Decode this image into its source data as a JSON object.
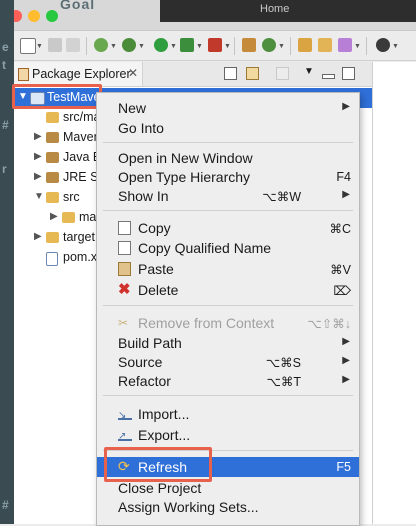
{
  "background": {
    "top_text": "Goal",
    "top_right_text": "Home",
    "left_chars": [
      "e",
      "t",
      "#",
      "r",
      "#"
    ]
  },
  "explorer": {
    "tab_label": "Package Explorer",
    "tab_close": "✕",
    "tree": [
      {
        "label": "TestMaven",
        "twisty": "▼",
        "icon": "maven-project-icon",
        "selected": true
      },
      {
        "label": "src/ma",
        "twisty": "",
        "icon": "source-folder-icon"
      },
      {
        "label": "Maven",
        "twisty": "▶",
        "icon": "library-icon"
      },
      {
        "label": "Java E",
        "twisty": "▶",
        "icon": "library-icon"
      },
      {
        "label": "JRE Sy",
        "twisty": "▶",
        "icon": "library-icon"
      },
      {
        "label": "src",
        "twisty": "▼",
        "icon": "folder-icon"
      },
      {
        "label": "mai",
        "twisty": "▶",
        "icon": "folder-icon"
      },
      {
        "label": "target",
        "twisty": "▶",
        "icon": "folder-icon"
      },
      {
        "label": "pom.x",
        "twisty": "",
        "icon": "pom-file-icon"
      }
    ]
  },
  "context_menu": {
    "items": [
      {
        "label": "New",
        "shortcut": "",
        "submenu": true
      },
      {
        "label": "Go Into",
        "shortcut": "",
        "submenu": false
      },
      {
        "label": "Open in New Window",
        "shortcut": "",
        "submenu": false
      },
      {
        "label": "Open Type Hierarchy",
        "shortcut": "F4",
        "submenu": false
      },
      {
        "label": "Show In",
        "shortcut": "⌥⌘W",
        "submenu": true
      },
      {
        "label": "Copy",
        "shortcut": "⌘C",
        "icon": "copy-icon"
      },
      {
        "label": "Copy Qualified Name",
        "shortcut": "",
        "icon": "copy-qualified-name-icon"
      },
      {
        "label": "Paste",
        "shortcut": "⌘V",
        "icon": "paste-icon"
      },
      {
        "label": "Delete",
        "shortcut": "⌦",
        "icon": "delete-icon"
      },
      {
        "label": "Remove from Context",
        "shortcut": "⌥⇧⌘↓",
        "icon": "remove-context-icon",
        "disabled": true
      },
      {
        "label": "Build Path",
        "shortcut": "",
        "submenu": true
      },
      {
        "label": "Source",
        "shortcut": "⌥⌘S",
        "submenu": true
      },
      {
        "label": "Refactor",
        "shortcut": "⌥⌘T",
        "submenu": true
      },
      {
        "label": "Import...",
        "shortcut": "",
        "icon": "import-icon"
      },
      {
        "label": "Export...",
        "shortcut": "",
        "icon": "export-icon"
      },
      {
        "label": "Refresh",
        "shortcut": "F5",
        "icon": "refresh-icon",
        "highlighted": true
      },
      {
        "label": "Close Project",
        "shortcut": ""
      },
      {
        "label": "Assign Working Sets...",
        "shortcut": ""
      }
    ],
    "submenu_arrow": "▶"
  },
  "colors": {
    "selection": "#2f6fd8",
    "callout": "#e8614d"
  }
}
